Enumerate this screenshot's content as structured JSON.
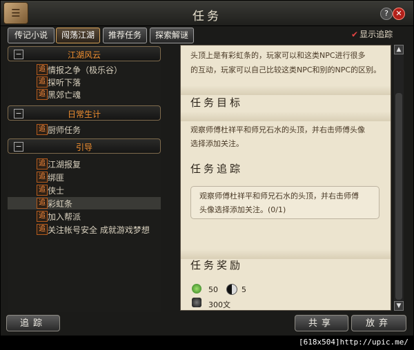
{
  "window": {
    "title": "任务",
    "logo_icon": "scroll-icon",
    "help_label": "?",
    "close_label": "✕"
  },
  "tabs": [
    {
      "label": "传记小说",
      "active": false
    },
    {
      "label": "闯荡江湖",
      "active": true
    },
    {
      "label": "推荐任务",
      "active": false
    },
    {
      "label": "探索解谜",
      "active": false
    }
  ],
  "show_track": {
    "label": "显示追踪",
    "checked": true
  },
  "tracker_tag": "追",
  "categories": [
    {
      "title": "江湖风云",
      "items": [
        "情报之争（极乐谷）",
        "探听下落",
        "黑郊亡魂"
      ]
    },
    {
      "title": "日常生计",
      "items": [
        "厨师任务"
      ]
    },
    {
      "title": "引导",
      "items": [
        "江湖报复",
        "绑匪",
        "侠士",
        "彩虹条",
        "加入帮派",
        "关注帐号安全 成就游戏梦想"
      ]
    }
  ],
  "selected_item": "彩虹条",
  "detail": {
    "intro": [
      "头顶上是有彩虹条的，玩家可以和这类NPC进行很多",
      "的互动，玩家可以自己比较这类NPC和别的NPC的区别。"
    ],
    "goal_heading": "任务目标",
    "goal_text": [
      "观察师傅杜祥平和师兄石水的头顶，并右击师傅头像",
      "选择添加关注。"
    ],
    "track_heading": "任务追踪",
    "track_text": [
      "观察师傅杜祥平和师兄石水的头顶，并右击师傅",
      "头像选择添加关注。(0/1)"
    ],
    "reward_heading": "任务奖励",
    "rewards": [
      {
        "icon": "experience-icon",
        "value": "50"
      },
      {
        "icon": "yin-yang-icon",
        "value": "5"
      },
      {
        "icon": "coins-icon",
        "value": "300文"
      }
    ]
  },
  "buttons": {
    "track": "追踪",
    "share": "共享",
    "abandon": "放弃"
  },
  "watermark": "[618x504]http://upic.me/"
}
